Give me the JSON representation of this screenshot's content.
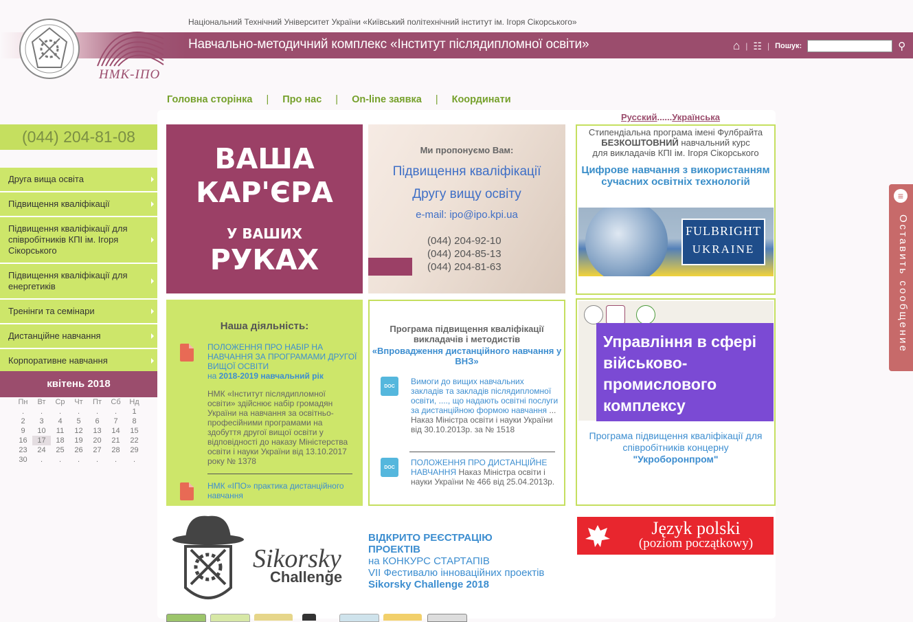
{
  "header": {
    "university": "Національний Технічний Університет України «Київський політехнічний інститут ім. Ігоря Сікорського»",
    "title": "Навчально-методичний комплекс «Інститут післядипломної освіти»",
    "logo_text": "НМК-ІПО",
    "search_label": "Пошук:",
    "search_value": ""
  },
  "nav": {
    "items": [
      "Головна сторінка",
      "Про нас",
      "On-line заявка",
      "Координати"
    ],
    "separator": "|"
  },
  "lang": {
    "ru": "Русский",
    "dots": "......",
    "uk": "Українська"
  },
  "sidebar": {
    "phone": "(044) 204-81-08",
    "items": [
      "Друга вища освіта",
      "Підвищення кваліфікації",
      "Підвищення кваліфікації для співробітників КПІ ім. Ігоря Сікорського",
      "Підвищення кваліфікації для енергетиків",
      "Тренінги та семінари",
      "Дистанційне навчання",
      "Корпоративне навчання"
    ]
  },
  "calendar": {
    "title": "квітень 2018",
    "days": [
      "Пн",
      "Вт",
      "Ср",
      "Чт",
      "Пт",
      "Сб",
      "Нд"
    ],
    "weeks": [
      [
        ".",
        ".",
        ".",
        ".",
        ".",
        ".",
        "1"
      ],
      [
        "2",
        "3",
        "4",
        "5",
        "6",
        "7",
        "8"
      ],
      [
        "9",
        "10",
        "11",
        "12",
        "13",
        "14",
        "15"
      ],
      [
        "16",
        "17",
        "18",
        "19",
        "20",
        "21",
        "22"
      ],
      [
        "23",
        "24",
        "25",
        "26",
        "27",
        "28",
        "29"
      ],
      [
        "30",
        ".",
        ".",
        ".",
        ".",
        ".",
        "."
      ]
    ],
    "today": "17"
  },
  "career": {
    "line1": "ВАША",
    "line2": "КАР'ЄРА",
    "line3": "У ВАШИХ",
    "line4": "РУКАХ"
  },
  "offer": {
    "heading": "Ми пропонуємо Вам:",
    "item1": "Підвищення кваліфікації",
    "item2": "Другу вищу освіту",
    "email": "e-mail: ipo@ipo.kpi.ua",
    "phones": [
      "(044) 204-92-10",
      "(044) 204-85-13",
      "(044) 204-81-63"
    ]
  },
  "fulbright": {
    "text1": "Стипендіальна програма імені Фулбрайта",
    "text2_bold": "БЕЗКОШТОВНИЙ",
    "text2_rest": " навчальний курс",
    "text3": "для викладачів КПІ ім. Ігоря Сікорського",
    "title": "Цифрове навчання з використанням сучасних освітніх технологій",
    "logo_line1": "FULBRIGHT",
    "logo_line2": "UKRAINE"
  },
  "activity": {
    "heading": "Наша діяльність:",
    "link1": "ПОЛОЖЕННЯ ПРО НАБІР НА НАВЧАННЯ ЗА ПРОГРАМАМИ ДРУГОЇ ВИЩОЇ ОСВІТИ",
    "link1_suffix": "на ",
    "link1_bold": "2018-2019 навчальний рік",
    "text": "НМК «Інститут післядипломної освіти» здійснює набір громадян України на навчання за освітньо-професійними програмами на здобуття другої вищої освіти у відповідності до наказу Міністерства освіти і науки України від 13.10.2017 року № 1378",
    "link2": "НМК «ІПО» практика дистанційного навчання"
  },
  "program": {
    "heading": "Програма підвищення кваліфікації викладачів і методистів",
    "title": "«Впровадження дистанційного навчання у ВНЗ»",
    "doc1_link": "Вимоги до вищих навчальних закладів та закладів післядипломної освіти, ...., що надають освітні послуги за дистанційною формою навчання",
    "doc1_text": " ... Наказ Міністра освіти і науки України від 30.10.2013р. за № 1518",
    "doc2_link": "ПОЛОЖЕННЯ ПРО ДИСТАНЦІЙНЕ НАВЧАННЯ",
    "doc2_text": " Наказ Міністра освіти і науки України № 466 від 25.04.2013р.",
    "doc_label": "DOC"
  },
  "military": {
    "banner": "Управління в сфері військово-промислового комплексу",
    "text": "Програма підвищення кваліфікації для співробітників концерну",
    "company": "\"Укроборонпром\""
  },
  "sikorsky": {
    "logo_text1": "Sikorsky",
    "logo_text2": "Challenge",
    "line1": "ВІДКРИТО РЕЄСТРАЦІЮ ПРОЕКТІВ",
    "line2": "на КОНКУРС СТАРТАПІВ",
    "line3": "VII Фестивалю інноваційних проектів",
    "line4": "Sikorsky Challenge 2018"
  },
  "polish": {
    "line1": "Język polski",
    "line2": "(poziom początkowy)"
  },
  "side_tab": {
    "label": "Оставить сообщение"
  },
  "colors": {
    "brand": "#9b4d6d",
    "accent_green": "#cde66a",
    "link": "#3d8ed0"
  }
}
